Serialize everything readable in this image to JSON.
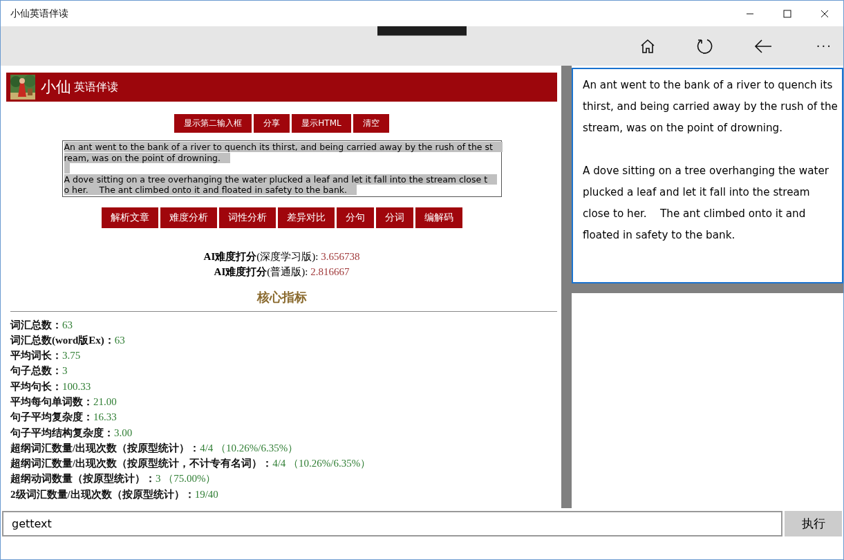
{
  "window": {
    "title": "小仙英语伴读"
  },
  "toolbar": {
    "more": "···"
  },
  "header": {
    "brand": "小仙",
    "subtitle": "英语伴读"
  },
  "top_buttons": [
    "显示第二输入框",
    "分享",
    "显示HTML",
    "清空"
  ],
  "source_text": {
    "paragraphs": [
      [
        "An ant went to the bank of a river to quench its thirst, and being carried away by the rush of the st",
        "ream, was on the point of drowning."
      ],
      [
        "A dove sitting on a tree overhanging the water plucked a leaf and let it fall into the stream close t",
        "o her.    The ant climbed onto it and floated in safety to the bank."
      ]
    ]
  },
  "action_buttons": [
    "解析文章",
    "难度分析",
    "词性分析",
    "差异对比",
    "分句",
    "分词",
    "编解码"
  ],
  "ai_scores": [
    {
      "label": "**AI难度打分**(深度学习版): ",
      "value": "3.656738"
    },
    {
      "label": "**AI难度打分**(普通版): ",
      "value": "2.816667"
    }
  ],
  "section_title": "核心指标",
  "metrics": [
    {
      "label": "词汇总数：",
      "value": "63"
    },
    {
      "label": "词汇总数(word版Ex)：",
      "value": "63"
    },
    {
      "label": "平均词长：",
      "value": "3.75"
    },
    {
      "label": "句子总数：",
      "value": "3"
    },
    {
      "label": "平均句长：",
      "value": "100.33"
    },
    {
      "label": "平均每句单词数：",
      "value": "21.00"
    },
    {
      "label": "句子平均复杂度：",
      "value": "16.33"
    },
    {
      "label": "句子平均结构复杂度：",
      "value": "3.00"
    },
    {
      "label": "超纲词汇数量/出现次数（按原型统计）：",
      "value": "4/4 （10.26%/6.35%）"
    },
    {
      "label": "超纲词汇数量/出现次数（按原型统计，不计专有名词）：",
      "value": "4/4 （10.26%/6.35%）"
    },
    {
      "label": "超纲动词数量（按原型统计）：",
      "value": "3 （75.00%）"
    },
    {
      "label": "2级词汇数量/出现次数（按原型统计）：",
      "value": "19/40"
    }
  ],
  "preview": {
    "paragraphs": [
      "An ant went to the bank of a river to quench its thirst, and being carried away by the rush of the stream, was on the point of drowning.",
      "A dove sitting on a tree overhanging the water plucked a leaf and let it fall into the stream close to her.    The ant climbed onto it and floated in safety to the bank."
    ]
  },
  "command": {
    "value": "gettext",
    "button": "执行"
  }
}
